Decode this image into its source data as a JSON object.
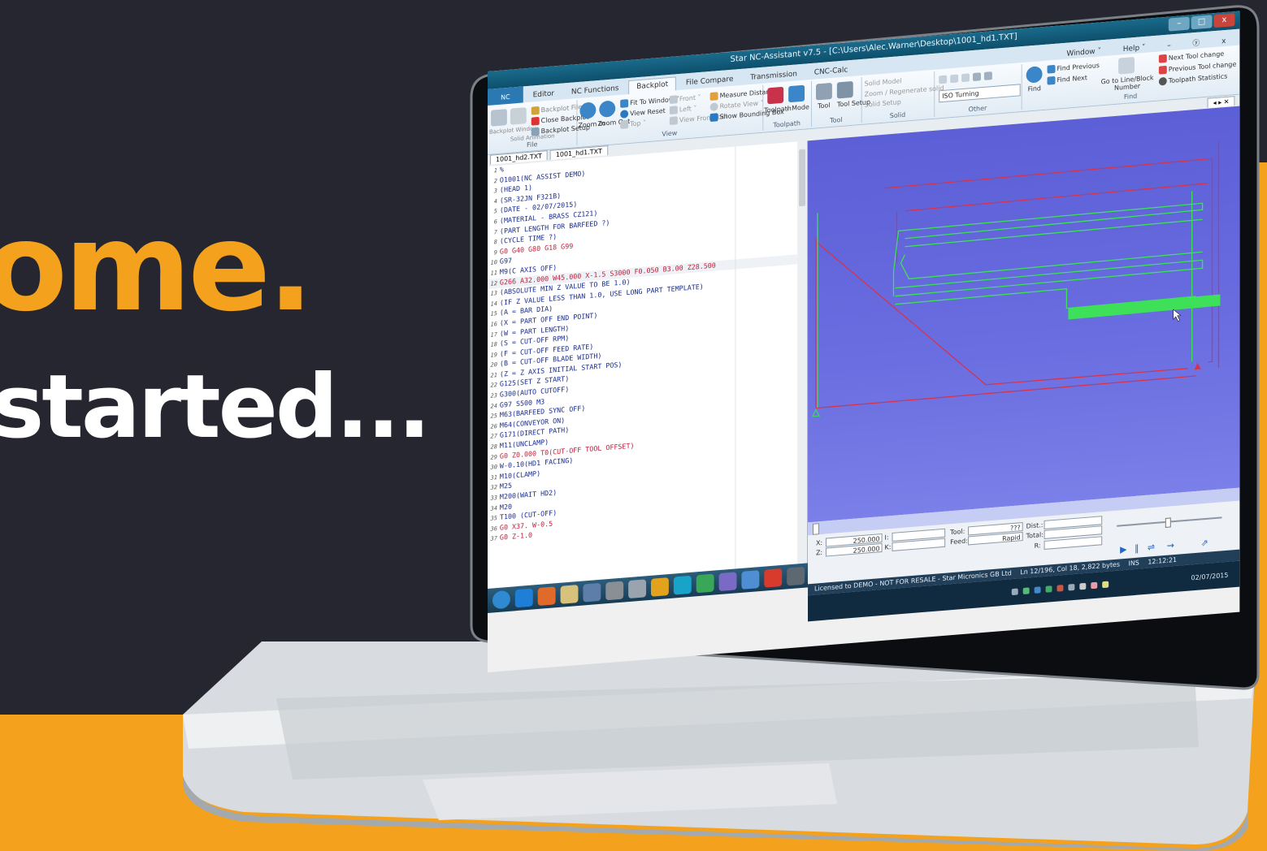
{
  "hero": {
    "line1": "ome.",
    "line2": "started...",
    "accent_color": "#f4a11d",
    "background_color": "#25262f"
  },
  "app": {
    "title": "Star NC-Assistant v7.5 - [C:\\Users\\Alec.Warner\\Desktop\\1001_hd1.TXT]",
    "window_controls": [
      "–",
      "□",
      "x"
    ],
    "menu_right": [
      "Window ˅",
      "Help ˅",
      "–",
      "ⓨ",
      "x"
    ]
  },
  "ribbon_tabs": [
    "Editor",
    "NC Functions",
    "Backplot",
    "File Compare",
    "Transmission",
    "CNC-Calc"
  ],
  "active_tab": "Backplot",
  "ribbon": {
    "file": {
      "label": "File",
      "backplot_window": "Backplot Window",
      "solid_animation": "Solid Animation",
      "backplot_file": "Backplot File ˅",
      "close_backplot": "Close Backplot",
      "backplot_setup": "Backplot Setup"
    },
    "view": {
      "label": "View",
      "zoom_in": "Zoom In",
      "zoom_out": "Zoom Out",
      "fit_to_window": "Fit To Window ˅",
      "view_reset": "View Reset",
      "top": "Top ˅",
      "front": "Front ˅",
      "left": "Left ˅",
      "view_from_tool": "View From Tool",
      "measure_distance": "Measure Distance",
      "rotate_view": "Rotate View ˅",
      "show_bounding_box": "Show Bounding Box ˅"
    },
    "toolpath": {
      "label": "Toolpath",
      "toolpath": "Toolpath",
      "mode": "Mode"
    },
    "tool": {
      "label": "Tool",
      "tool": "Tool",
      "tool_setup": "Tool Setup"
    },
    "solid": {
      "label": "Solid",
      "solid_model": "Solid Model",
      "zoom_regenerate": "Zoom / Regenerate solid",
      "solid_setup": "Solid Setup"
    },
    "other": {
      "label": "Other",
      "mode_select": "ISO Turning"
    },
    "find": {
      "label": "Find",
      "find": "Find",
      "find_previous": "Find Previous",
      "find_next": "Find Next",
      "goto_line": "Go to Line/Block Number",
      "next_tool_change": "Next Tool change",
      "previous_tool_change": "Previous Tool change",
      "toolpath_statistics": "Toolpath Statistics"
    }
  },
  "doc_tabs": [
    "1001_hd2.TXT",
    "1001_hd1.TXT"
  ],
  "doc_pin": "◂ ▸ ✕",
  "code_lines": [
    {
      "n": "1",
      "text": "%",
      "red": false
    },
    {
      "n": "2",
      "text": "O1001(NC ASSIST DEMO)",
      "red": false
    },
    {
      "n": "3",
      "text": "(HEAD 1)",
      "red": false
    },
    {
      "n": "4",
      "text": "(SR-32JN F321B)",
      "red": false
    },
    {
      "n": "5",
      "text": "(DATE - 02/07/2015)",
      "red": false
    },
    {
      "n": "6",
      "text": "(MATERIAL - BRASS CZ121)",
      "red": false
    },
    {
      "n": "7",
      "text": "(PART LENGTH FOR BARFEED ?)",
      "red": false
    },
    {
      "n": "8",
      "text": "(CYCLE TIME ?)",
      "red": false
    },
    {
      "n": "9",
      "text": "G0 G40 G80 G18 G99",
      "red": true
    },
    {
      "n": "10",
      "text": "G97",
      "red": false
    },
    {
      "n": "11",
      "text": "M9(C AXIS OFF)",
      "red": false
    },
    {
      "n": "12",
      "text": "G266 A32.000 W45.000 X-1.5 S3000 F0.050 B3.00 Z28.500",
      "red": true
    },
    {
      "n": "13",
      "text": "(ABSOLUTE MIN Z VALUE TO BE 1.0)",
      "red": false
    },
    {
      "n": "14",
      "text": "(IF Z VALUE LESS THAN 1.0, USE LONG PART TEMPLATE)",
      "red": false
    },
    {
      "n": "15",
      "text": "(A = BAR DIA)",
      "red": false
    },
    {
      "n": "16",
      "text": "(X = PART OFF END POINT)",
      "red": false
    },
    {
      "n": "17",
      "text": "(W = PART LENGTH)",
      "red": false
    },
    {
      "n": "18",
      "text": "(S = CUT-OFF RPM)",
      "red": false
    },
    {
      "n": "19",
      "text": "(F = CUT-OFF FEED RATE)",
      "red": false
    },
    {
      "n": "20",
      "text": "(B = CUT-OFF BLADE WIDTH)",
      "red": false
    },
    {
      "n": "21",
      "text": "(Z = Z AXIS INITIAL START POS)",
      "red": false
    },
    {
      "n": "22",
      "text": "G125(SET Z START)",
      "red": false
    },
    {
      "n": "23",
      "text": "G300(AUTO CUTOFF)",
      "red": false
    },
    {
      "n": "24",
      "text": "G97 S500 M3",
      "red": false
    },
    {
      "n": "25",
      "text": "M63(BARFEED SYNC OFF)",
      "red": false
    },
    {
      "n": "26",
      "text": "M64(CONVEYOR ON)",
      "red": false
    },
    {
      "n": "27",
      "text": "G171(DIRECT PATH)",
      "red": false
    },
    {
      "n": "28",
      "text": "M11(UNCLAMP)",
      "red": false
    },
    {
      "n": "29",
      "text": "G0 Z0.000 T0(CUT-OFF TOOL OFFSET)",
      "red": true
    },
    {
      "n": "30",
      "text": "W-0.10(HD1 FACING)",
      "red": false
    },
    {
      "n": "31",
      "text": "M10(CLAMP)",
      "red": false
    },
    {
      "n": "32",
      "text": "M25",
      "red": false
    },
    {
      "n": "33",
      "text": "M200(WAIT HD2)",
      "red": false
    },
    {
      "n": "34",
      "text": "M20",
      "red": false
    },
    {
      "n": "35",
      "text": "T100 (CUT-OFF)",
      "red": false
    },
    {
      "n": "36",
      "text": "G0 X37. W-0.5",
      "red": true
    },
    {
      "n": "37",
      "text": "G0 Z-1.0",
      "red": true
    }
  ],
  "highlighted_line": "12",
  "coords": {
    "x_label": "X:",
    "z_label": "Z:",
    "x_value": "250.000",
    "z_value": "250.000",
    "i_label": "I:",
    "k_label": "K:",
    "i_value": "",
    "k_value": "",
    "tool_label": "Tool:",
    "tool_value": "???",
    "feed_label": "Feed:",
    "feed_value": "Rapid",
    "dist_label": "Dist.:",
    "total_label": "Total:",
    "r_label": "R:"
  },
  "playback": [
    "▶",
    "‖",
    "⇌",
    "⇝",
    "⇗"
  ],
  "status": {
    "license": "Licensed to DEMO - NOT FOR RESALE - Star Micronics GB Ltd",
    "position": "Ln 12/196, Col 18, 2,822 bytes",
    "mode": "INS",
    "time": "12:12:21",
    "date": "02/07/2015"
  },
  "colors": {
    "viewport": "#5c5fd6",
    "toolpath_green": "#3ee05a",
    "toolpath_red": "#d8324a"
  }
}
